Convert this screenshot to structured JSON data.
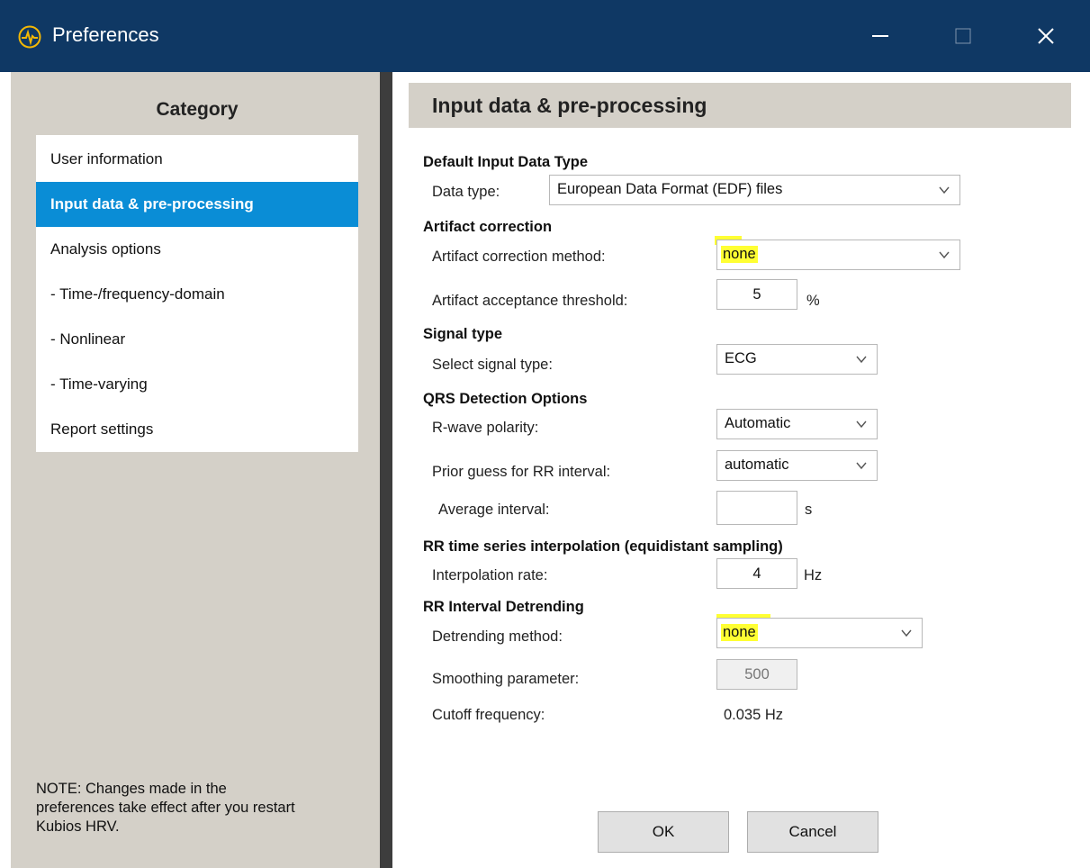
{
  "window": {
    "title": "Preferences",
    "minimize_label": "—",
    "close_label": "✕"
  },
  "category": {
    "title": "Category",
    "items": [
      {
        "label": "User information"
      },
      {
        "label": "Input data & pre-processing",
        "selected": true
      },
      {
        "label": "Analysis options"
      },
      {
        "label": "- Time-/frequency-domain"
      },
      {
        "label": "- Nonlinear"
      },
      {
        "label": "- Time-varying"
      },
      {
        "label": "Report settings"
      }
    ],
    "note": "NOTE: Changes made in the preferences take effect after you restart Kubios HRV."
  },
  "panel": {
    "title": "Input data & pre-processing",
    "default_input": {
      "heading": "Default Input Data Type",
      "data_type_label": "Data type:",
      "data_type_value": "European Data Format (EDF) files"
    },
    "artifact": {
      "heading": "Artifact correction",
      "method_label": "Artifact correction method:",
      "method_value": "none",
      "threshold_label": "Artifact acceptance threshold:",
      "threshold_value": "5",
      "threshold_unit": "%"
    },
    "signal": {
      "heading": "Signal type",
      "select_label": "Select signal type:",
      "select_value": "ECG"
    },
    "qrs": {
      "heading": "QRS Detection Options",
      "polarity_label": "R-wave polarity:",
      "polarity_value": "Automatic",
      "prior_label": "Prior guess for RR interval:",
      "prior_value": "automatic",
      "avg_label": "Average interval:",
      "avg_value": "",
      "avg_unit": "s"
    },
    "interp": {
      "heading": "RR time series interpolation (equidistant sampling)",
      "rate_label": "Interpolation rate:",
      "rate_value": "4",
      "rate_unit": "Hz"
    },
    "detrend": {
      "heading": "RR Interval Detrending",
      "method_label": "Detrending method:",
      "method_value": "none",
      "smooth_label": "Smoothing parameter:",
      "smooth_value": "500",
      "cutoff_label": "Cutoff frequency:",
      "cutoff_value": "0.035 Hz"
    }
  },
  "buttons": {
    "ok": "OK",
    "cancel": "Cancel"
  },
  "colors": {
    "titlebar": "#0f3864",
    "selected": "#0a8dd6",
    "highlight": "#ffff33",
    "panel_gray": "#d4d0c8"
  }
}
